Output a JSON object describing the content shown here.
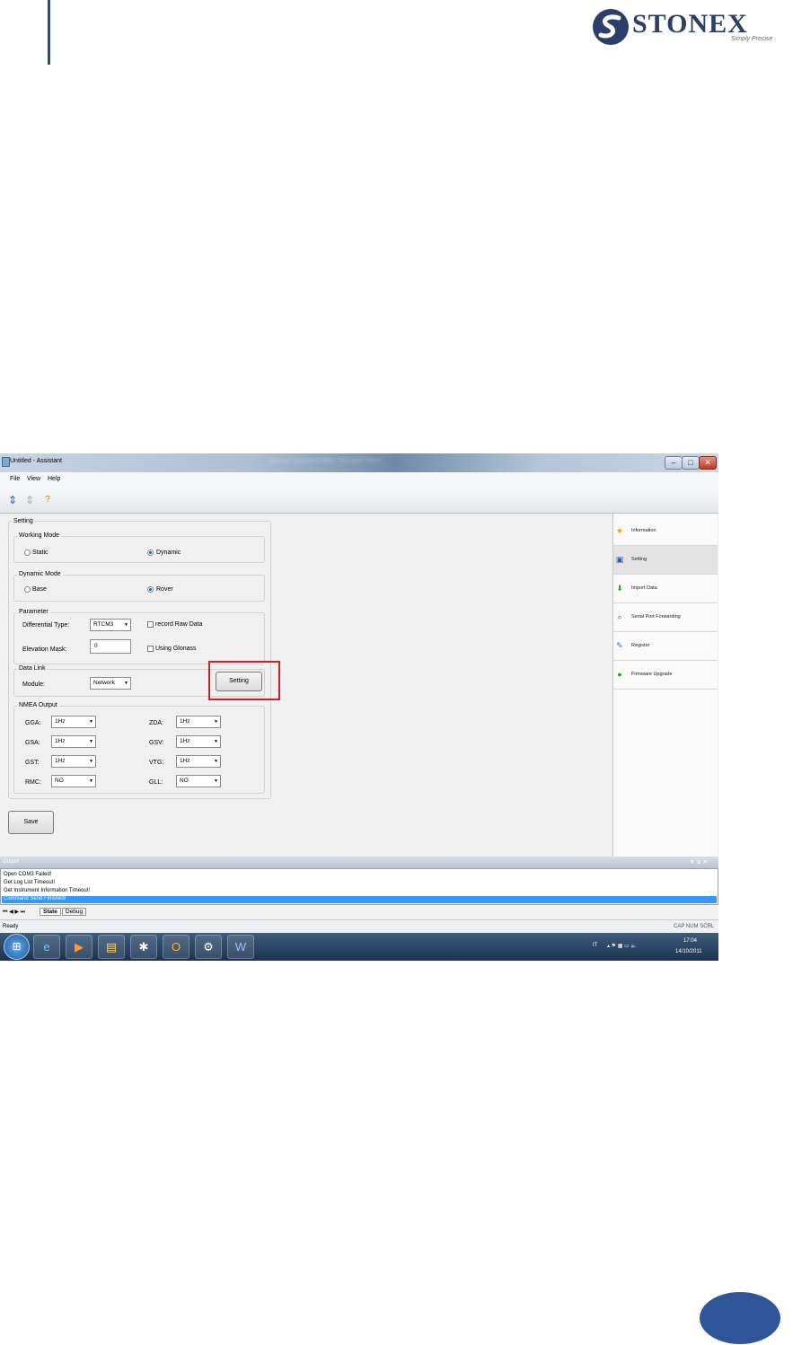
{
  "logo": {
    "brand": "STONEX",
    "tagline": "Simply Precise"
  },
  "window": {
    "title": "Untitled - Assistant",
    "blurred_title": "[blurred document title] - Microsoft Word"
  },
  "menu": [
    "File",
    "View",
    "Help"
  ],
  "setting": {
    "section_title": "Setting",
    "working_mode": {
      "legend": "Working Mode",
      "static": "Static",
      "dynamic": "Dynamic",
      "selected": "Dynamic"
    },
    "dynamic_mode": {
      "legend": "Dynamic Mode",
      "base": "Base",
      "rover": "Rover",
      "selected": "Rover"
    },
    "parameter": {
      "legend": "Parameter",
      "differential_type_label": "Differential Type:",
      "differential_type_value": "RTCM3",
      "record_raw_data": "record Raw Data",
      "elevation_mask_label": "Elevation Mask:",
      "elevation_mask_value": "0",
      "using_glonass": "Using Glonass"
    },
    "data_link": {
      "legend": "Data Link",
      "module_label": "Module:",
      "module_value": "Network",
      "setting_button": "Setting"
    },
    "nmea": {
      "legend": "NMEA Output",
      "gga_label": "GGA:",
      "gga_value": "1Hz",
      "gsa_label": "GSA:",
      "gsa_value": "1Hz",
      "gst_label": "GST:",
      "gst_value": "1Hz",
      "rmc_label": "RMC:",
      "rmc_value": "NO",
      "zda_label": "ZDA:",
      "zda_value": "1Hz",
      "gsv_label": "GSV:",
      "gsv_value": "1Hz",
      "vtg_label": "VTG:",
      "vtg_value": "1Hz",
      "gll_label": "GLL:",
      "gll_value": "NO"
    },
    "save_button": "Save"
  },
  "sidebar": [
    {
      "label": "Information",
      "icon": "star-icon"
    },
    {
      "label": "Setting",
      "icon": "settings-icon",
      "active": true
    },
    {
      "label": "Import Data",
      "icon": "download-icon"
    },
    {
      "label": "Serial Port Forwarding",
      "icon": "serial-port-icon"
    },
    {
      "label": "Register",
      "icon": "register-icon"
    },
    {
      "label": "Firmware Upgrade",
      "icon": "firmware-icon"
    }
  ],
  "output": {
    "title": "Output",
    "lines": [
      "Open COM3 Failed!",
      "Get Log List Timeout!",
      "Get Instrument Information Timeout!",
      "Command Send Finished!"
    ],
    "selected_line": "Command Send Finished!"
  },
  "tabs": [
    "State",
    "Debug"
  ],
  "status": {
    "left": "Ready",
    "right": "CAP  NUM  SCRL"
  },
  "taskbar": {
    "lang": "IT",
    "time": "17:04",
    "date": "14/10/2011"
  },
  "colors": {
    "accent": "#2e5597",
    "highlight": "#d1202a",
    "selection": "#3399ff"
  }
}
